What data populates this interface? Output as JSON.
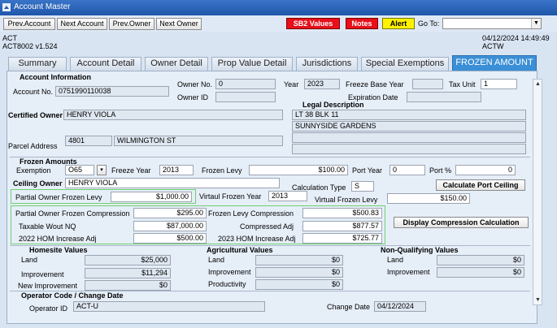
{
  "window": {
    "title": "Account Master"
  },
  "toolbar": {
    "prev_account": "Prev.Account",
    "next_account": "Next Account",
    "prev_owner": "Prev.Owner",
    "next_owner": "Next Owner",
    "sb2_values": "SB2 Values",
    "notes": "Notes",
    "alert": "Alert",
    "goto_label": "Go To:",
    "goto_value": ""
  },
  "header": {
    "left_line1": "ACT",
    "left_line2": "ACT8002  v1.524",
    "right_line1": "04/12/2024 14:49:49",
    "right_line2": "ACTW"
  },
  "tabs": [
    "Summary",
    "Account Detail",
    "Owner Detail",
    "Prop Value Detail",
    "Jurisdictions",
    "Special Exemptions",
    "FROZEN AMOUNT"
  ],
  "account_info": {
    "heading": "Account Information",
    "account_no_label": "Account No.",
    "account_no": "0751990110038",
    "owner_no_label": "Owner No.",
    "owner_no": "0",
    "owner_id_label": "Owner ID",
    "owner_id": "",
    "year_label": "Year",
    "year": "2023",
    "freeze_base_year_label": "Freeze Base Year",
    "freeze_base_year": "",
    "tax_unit_label": "Tax Unit",
    "tax_unit": "1",
    "expiration_date_label": "Expiration Date",
    "expiration_date": "",
    "certified_owner_label": "Certified Owner",
    "certified_owner": "HENRY VIOLA",
    "legal_description_label": "Legal Description",
    "legal_lines": [
      "LT 38 BLK 11",
      "SUNNYSIDE GARDENS",
      "",
      ""
    ],
    "parcel_address_label": "Parcel Address",
    "parcel_number": "4801",
    "parcel_street": "WILMINGTON ST"
  },
  "frozen": {
    "heading": "Frozen Amounts",
    "exemption_label": "Exemption",
    "exemption": "O65",
    "freeze_year_label": "Freeze Year",
    "freeze_year": "2013",
    "frozen_levy_label": "Frozen Levy",
    "frozen_levy": "$100.00",
    "port_year_label": "Port Year",
    "port_year": "0",
    "port_pct_label": "Port %",
    "port_pct": "0",
    "ceiling_owner_label": "Ceiling Owner",
    "ceiling_owner": "HENRY VIOLA",
    "calculation_type_label": "Calculation Type",
    "calculation_type": "S",
    "calculate_port_ceiling": "Calculate Port Ceiling",
    "partial_owner_frozen_levy_label": "Partial Owner Frozen Levy",
    "partial_owner_frozen_levy": "$1,000.00",
    "virtual_frozen_year_label": "Virtaul Frozen Year",
    "virtual_frozen_year": "2013",
    "virtual_frozen_levy_label": "Virtual Frozen Levy",
    "virtual_frozen_levy": "$150.00",
    "partial_owner_frozen_compression_label": "Partial Owner Frozen Compression",
    "partial_owner_frozen_compression": "$295.00",
    "frozen_levy_compression_label": "Frozen Levy Compression",
    "frozen_levy_compression": "$500.83",
    "taxable_wout_nq_label": "Taxable Wout NQ",
    "taxable_wout_nq": "$87,000.00",
    "compressed_adj_label": "Compressed Adj",
    "compressed_adj": "$877.57",
    "hom_increase_2022_label": "2022 HOM Increase Adj",
    "hom_increase_2022": "$500.00",
    "hom_increase_2023_label": "2023 HOM Increase Adj",
    "hom_increase_2023": "$725.77",
    "display_compression": "Display Compression Calculation"
  },
  "homesite": {
    "heading": "Homesite Values",
    "land_label": "Land",
    "land": "$25,000",
    "improvement_label": "Improvement",
    "improvement": "$11,294",
    "new_improvement_label": "New Improvement",
    "new_improvement": "$0"
  },
  "agricultural": {
    "heading": "Agricultural Values",
    "land_label": "Land",
    "land": "$0",
    "improvement_label": "Improvement",
    "improvement": "$0",
    "productivity_label": "Productivity",
    "productivity": "$0"
  },
  "nonqualifying": {
    "heading": "Non-Qualifying Values",
    "land_label": "Land",
    "land": "$0",
    "improvement_label": "Improvement",
    "improvement": "$0"
  },
  "operator": {
    "heading": "Operator Code / Change Date",
    "operator_id_label": "Operator ID",
    "operator_id": "ACT-U",
    "change_date_label": "Change Date",
    "change_date": "04/12/2024"
  }
}
